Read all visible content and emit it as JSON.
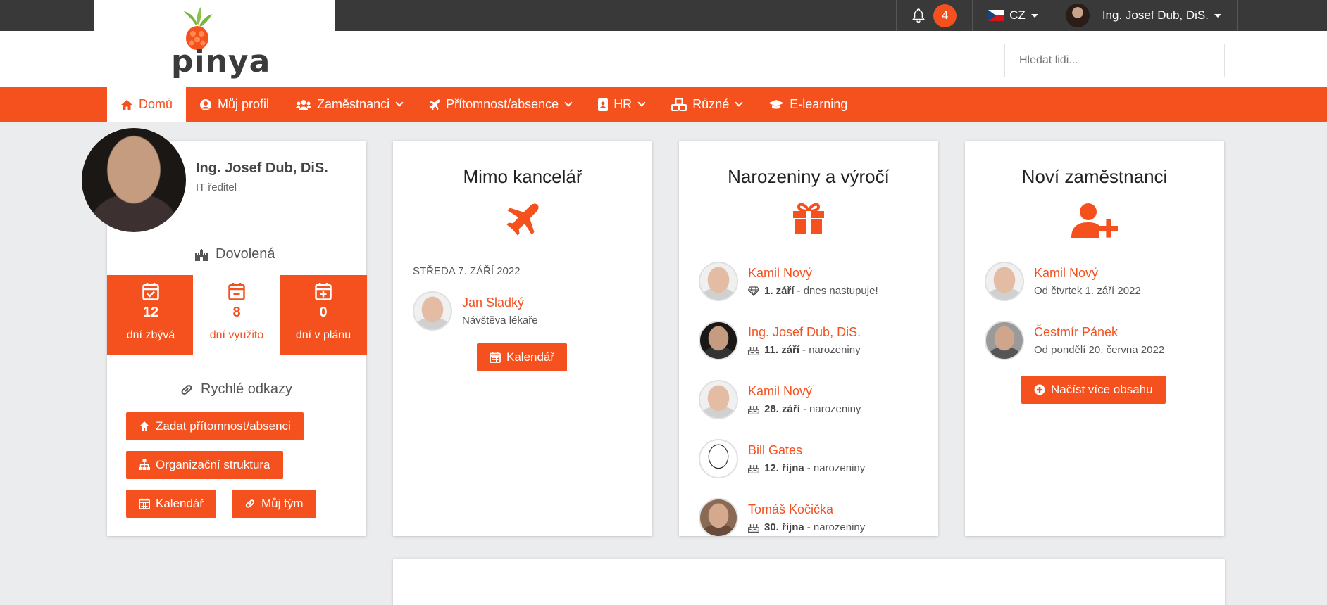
{
  "topbar": {
    "notification_count": "4",
    "language": "CZ",
    "user_name": "Ing. Josef Dub, DiS."
  },
  "header": {
    "logo_text": "pinya",
    "search_placeholder": "Hledat lidi..."
  },
  "nav": {
    "items": [
      {
        "label": "Domů",
        "icon": "home-icon",
        "active": true
      },
      {
        "label": "Můj profil",
        "icon": "user-circle-icon"
      },
      {
        "label": "Zaměstnanci",
        "icon": "users-icon"
      },
      {
        "label": "Přítomnost/absence",
        "icon": "plane-icon"
      },
      {
        "label": "HR",
        "icon": "id-badge-icon"
      },
      {
        "label": "Různé",
        "icon": "cubes-icon"
      },
      {
        "label": "E-learning",
        "icon": "graduation-cap-icon"
      }
    ]
  },
  "profile": {
    "name": "Ing. Josef Dub, DiS.",
    "role": "IT ředitel",
    "vacation_title": "Dovolená",
    "stats": [
      {
        "value": "12",
        "label": "dní zbývá"
      },
      {
        "value": "8",
        "label": "dní využito"
      },
      {
        "value": "0",
        "label": "dní v plánu"
      }
    ],
    "quick_links_title": "Rychlé odkazy",
    "links": {
      "attendance": "Zadat přítomnost/absenci",
      "org": "Organizační struktura",
      "calendar": "Kalendář",
      "team": "Můj tým"
    }
  },
  "out_of_office": {
    "title": "Mimo kancelář",
    "date": "STŘEDA 7. ZÁŘÍ 2022",
    "person_name": "Jan Sladký",
    "person_reason": "Návštěva lékaře",
    "button": "Kalendář"
  },
  "birthdays": {
    "title": "Narozeniny a výročí",
    "items": [
      {
        "name": "Kamil Nový",
        "date": "1. září",
        "suffix": "- dnes nastupuje!",
        "icon": "diamond-icon"
      },
      {
        "name": "Ing. Josef Dub, DiS.",
        "date": "11. září",
        "suffix": "- narozeniny",
        "icon": "cake-icon"
      },
      {
        "name": "Kamil Nový",
        "date": "28. září",
        "suffix": "- narozeniny",
        "icon": "cake-icon"
      },
      {
        "name": "Bill Gates",
        "date": "12. října",
        "suffix": "- narozeniny",
        "icon": "cake-icon"
      },
      {
        "name": "Tomáš Kočička",
        "date": "30. října",
        "suffix": "- narozeniny",
        "icon": "cake-icon"
      }
    ]
  },
  "new_employees": {
    "title": "Noví zaměstnanci",
    "items": [
      {
        "name": "Kamil Nový",
        "since": "Od čtvrtek 1. září 2022"
      },
      {
        "name": "Čestmír Pánek",
        "since": "Od pondělí 20. června 2022"
      }
    ],
    "button": "Načíst více obsahu"
  },
  "colors": {
    "accent": "#f4511e",
    "topbar": "#393939",
    "background": "#ebecee"
  }
}
